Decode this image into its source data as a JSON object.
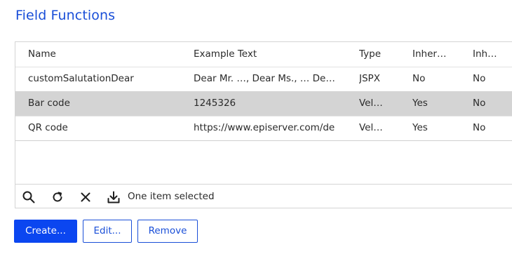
{
  "page": {
    "title": "Field Functions"
  },
  "table": {
    "headers": [
      "Name",
      "Example Text",
      "Type",
      "Inheri…",
      "Inhe…"
    ],
    "rows": [
      [
        "customSalutationDear",
        "Dear Mr. …, Dear Ms., … Dear…",
        "JSPX",
        "No",
        "No"
      ],
      [
        "Bar code",
        "1245326",
        "Velo…",
        "Yes",
        "No"
      ],
      [
        "QR code",
        "https://www.episerver.com/de",
        "Velo…",
        "Yes",
        "No"
      ]
    ],
    "selected_row": 1
  },
  "toolbar": {
    "icons": [
      "search-icon",
      "refresh-icon",
      "close-icon",
      "download-icon"
    ],
    "status": "One item selected"
  },
  "buttons": {
    "create": "Create...",
    "edit": "Edit...",
    "remove": "Remove"
  },
  "colors": {
    "accent": "#1a4fd8",
    "primary_button": "#0b46f0",
    "selected_row": "#d4d4d4"
  }
}
